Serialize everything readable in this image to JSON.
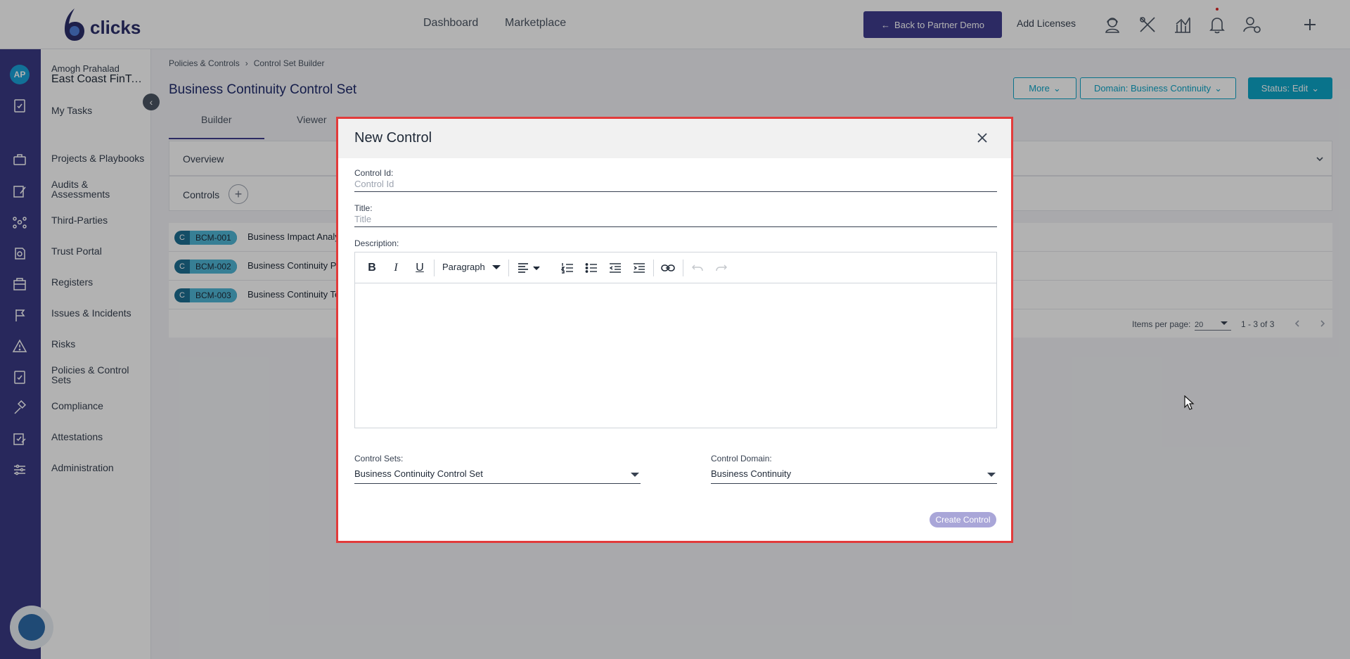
{
  "topbar": {
    "logo_text": "clicks",
    "nav": [
      "Dashboard",
      "Marketplace"
    ],
    "back_button": "Back to Partner Demo",
    "add_licenses": "Add Licenses",
    "icons": [
      "support-agent-icon",
      "tools-icon",
      "analytics-icon",
      "bell-icon",
      "user-settings-icon",
      "plus-icon"
    ]
  },
  "rail": {
    "avatar_initials": "AP"
  },
  "sidebar": {
    "user_name": "Amogh Prahalad",
    "org_name": "East Coast FinTe...",
    "collapse_glyph": "‹",
    "items": [
      {
        "label": "My Tasks",
        "icon": "task-check-icon"
      },
      {
        "label": "Projects & Playbooks",
        "icon": "briefcase-icon"
      },
      {
        "label": "Audits & Assessments",
        "icon": "edit-doc-icon"
      },
      {
        "label": "Third-Parties",
        "icon": "network-icon"
      },
      {
        "label": "Trust Portal",
        "icon": "portal-icon"
      },
      {
        "label": "Registers",
        "icon": "register-icon"
      },
      {
        "label": "Issues & Incidents",
        "icon": "flag-icon"
      },
      {
        "label": "Risks",
        "icon": "warning-icon"
      },
      {
        "label": "Policies & Control Sets",
        "icon": "policy-icon"
      },
      {
        "label": "Compliance",
        "icon": "gavel-icon"
      },
      {
        "label": "Attestations",
        "icon": "attest-icon"
      },
      {
        "label": "Administration",
        "icon": "sliders-icon"
      }
    ]
  },
  "page": {
    "breadcrumb": [
      "Policies & Controls",
      "Control Set Builder"
    ],
    "breadcrumb_sep": "›",
    "title": "Business Continuity Control Set",
    "more_button": "More",
    "domain_button": "Domain: Business Continuity",
    "status_button": "Status: Edit",
    "tabs": [
      "Builder",
      "Viewer"
    ],
    "overview_label": "Overview",
    "controls_label": "Controls",
    "controls_plus": "+",
    "rows": [
      {
        "badge": "C",
        "code": "BCM-001",
        "title": "Business Impact Analy"
      },
      {
        "badge": "C",
        "code": "BCM-002",
        "title": "Business Continuity P"
      },
      {
        "badge": "C",
        "code": "BCM-003",
        "title": "Business Continuity Te"
      }
    ],
    "pager": {
      "items_per_page_label": "Items per page:",
      "items_per_page_value": "20",
      "range": "1 - 3 of 3"
    }
  },
  "modal": {
    "title": "New Control",
    "control_id_label": "Control Id:",
    "control_id_placeholder": "Control Id",
    "title_label": "Title:",
    "title_placeholder": "Title",
    "description_label": "Description:",
    "toolbar": {
      "bold": "B",
      "italic": "I",
      "underline": "U",
      "paragraph": "Paragraph"
    },
    "control_sets_label": "Control Sets:",
    "control_sets_value": "Business Continuity Control Set",
    "control_domain_label": "Control Domain:",
    "control_domain_value": "Business Continuity",
    "create_button": "Create Control"
  },
  "colors": {
    "rail": "#3a3a84",
    "primary": "#3f3d8f",
    "accent": "#0ea5c8",
    "modal_border": "#e23b3b",
    "create_disabled": "#a9a6d8"
  }
}
